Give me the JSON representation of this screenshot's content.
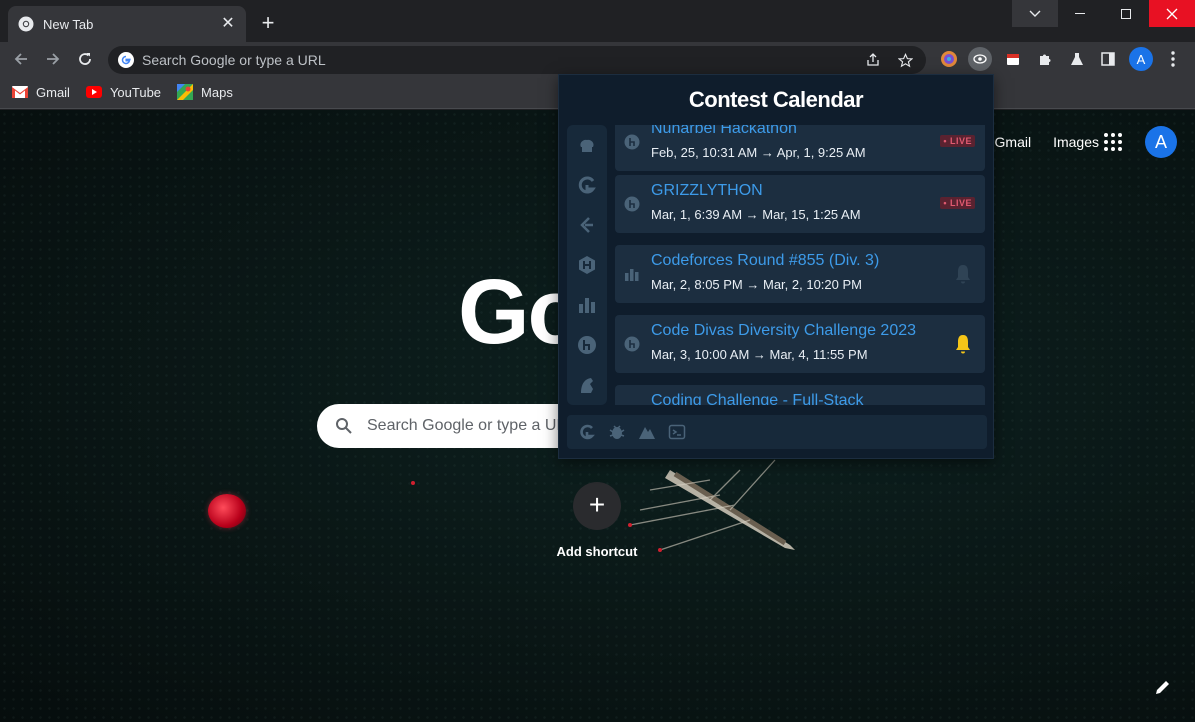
{
  "tab": {
    "title": "New Tab",
    "close_icon": "close-icon"
  },
  "toolbar": {
    "omnibox_placeholder": "Search Google or type a URL",
    "profile_initial": "A"
  },
  "bookmarks": [
    {
      "label": "Gmail",
      "icon": "gmail-icon"
    },
    {
      "label": "YouTube",
      "icon": "youtube-icon"
    },
    {
      "label": "Maps",
      "icon": "maps-icon"
    }
  ],
  "page": {
    "links": [
      "Gmail",
      "Images"
    ],
    "avatar_initial": "A",
    "logo_text": "Go",
    "search_placeholder": "Search Google or type a URL",
    "add_shortcut_label": "Add shortcut"
  },
  "popup": {
    "title": "Contest Calendar",
    "contests": [
      {
        "name": "Nunarbel Hackathon",
        "dates": "Feb, 25, 10:31 AM → Apr, 1, 9:25 AM",
        "badge": "• LIVE",
        "platform": "hackerearth-icon"
      },
      {
        "name": "GRIZZLYTHON",
        "dates": "Mar, 1, 6:39 AM → Mar, 15, 1:25 AM",
        "badge": "• LIVE",
        "platform": "hackerearth-icon"
      },
      {
        "name": "Codeforces Round #855 (Div. 3)",
        "dates": "Mar, 2, 8:05 PM → Mar, 2, 10:20 PM",
        "badge": "",
        "platform": "codeforces-icon"
      },
      {
        "name": "Code Divas Diversity Challenge 2023",
        "dates": "Mar, 3, 10:00 AM → Mar, 4, 11:55 PM",
        "badge": "",
        "platform": "hackerearth-icon"
      },
      {
        "name": "Coding Challenge - Full-Stack",
        "dates": "",
        "badge": "",
        "platform": "hackerearth-icon"
      }
    ]
  },
  "colors": {
    "popup_bg": "#0f1d2c",
    "card_bg": "#1c2e40",
    "link_blue": "#3d9be9",
    "bell_active": "#f5c518",
    "live_red": "#e05a70",
    "close_red": "#e81123"
  }
}
